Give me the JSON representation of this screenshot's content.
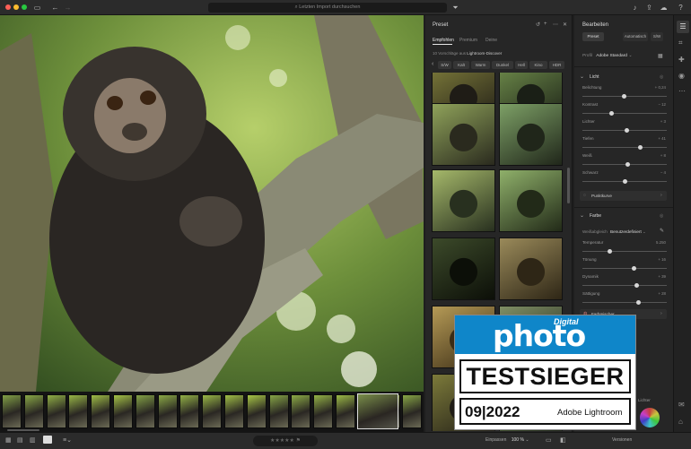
{
  "titlebar": {
    "search_placeholder": "Letzten Import durchsuchen"
  },
  "preset_panel": {
    "title": "Preset",
    "tabs": [
      "Empfohlen",
      "Premium",
      "Deine"
    ],
    "suggestion_prefix": "10 Vorschläge aus",
    "suggestion_source": "Lightroom-Discover",
    "chips": [
      "S/W",
      "Kalt",
      "Warm",
      "Dunkel",
      "Hell",
      "Kino",
      "HDR"
    ]
  },
  "edit_panel": {
    "title": "Bearbeiten",
    "buttons": {
      "preset": "Preset",
      "auto": "Automatisch",
      "bw": "S/W"
    },
    "profile_label": "Profil",
    "profile_value": "Adobe Standard",
    "light": {
      "header": "Licht",
      "sliders": [
        {
          "label": "Belichtung",
          "value": "+ 0,24"
        },
        {
          "label": "Kontrast",
          "value": "− 12"
        },
        {
          "label": "Lichter",
          "value": "+ 3"
        },
        {
          "label": "Tiefen",
          "value": "+ 41"
        },
        {
          "label": "Weiß",
          "value": "+ 8"
        },
        {
          "label": "Schwarz",
          "value": "− 4"
        }
      ],
      "curve_label": "Punktkurve"
    },
    "color": {
      "header": "Farbe",
      "wb_label": "Weißabgleich",
      "wb_value": "Benutzerdefiniert",
      "sliders": [
        {
          "label": "Temperatur",
          "value": "5.250"
        },
        {
          "label": "Tönung",
          "value": "+ 16"
        },
        {
          "label": "Dynamik",
          "value": "+ 39"
        },
        {
          "label": "Sättigung",
          "value": "+ 28"
        }
      ],
      "mixer_label": "Farbmischer",
      "lichter_label": "Lichter"
    }
  },
  "bottombar": {
    "zoom_label": "Einpassen",
    "zoom_value": "100 %",
    "versions_label": "Versionen"
  },
  "badge": {
    "brand_small": "Digital",
    "brand_large": "photo",
    "title": "TESTSIEGER",
    "issue": "09|2022",
    "product": "Adobe Lightroom"
  },
  "colors": {
    "accent": "#1a8fd6",
    "badge_blue": "#0f86c9"
  }
}
